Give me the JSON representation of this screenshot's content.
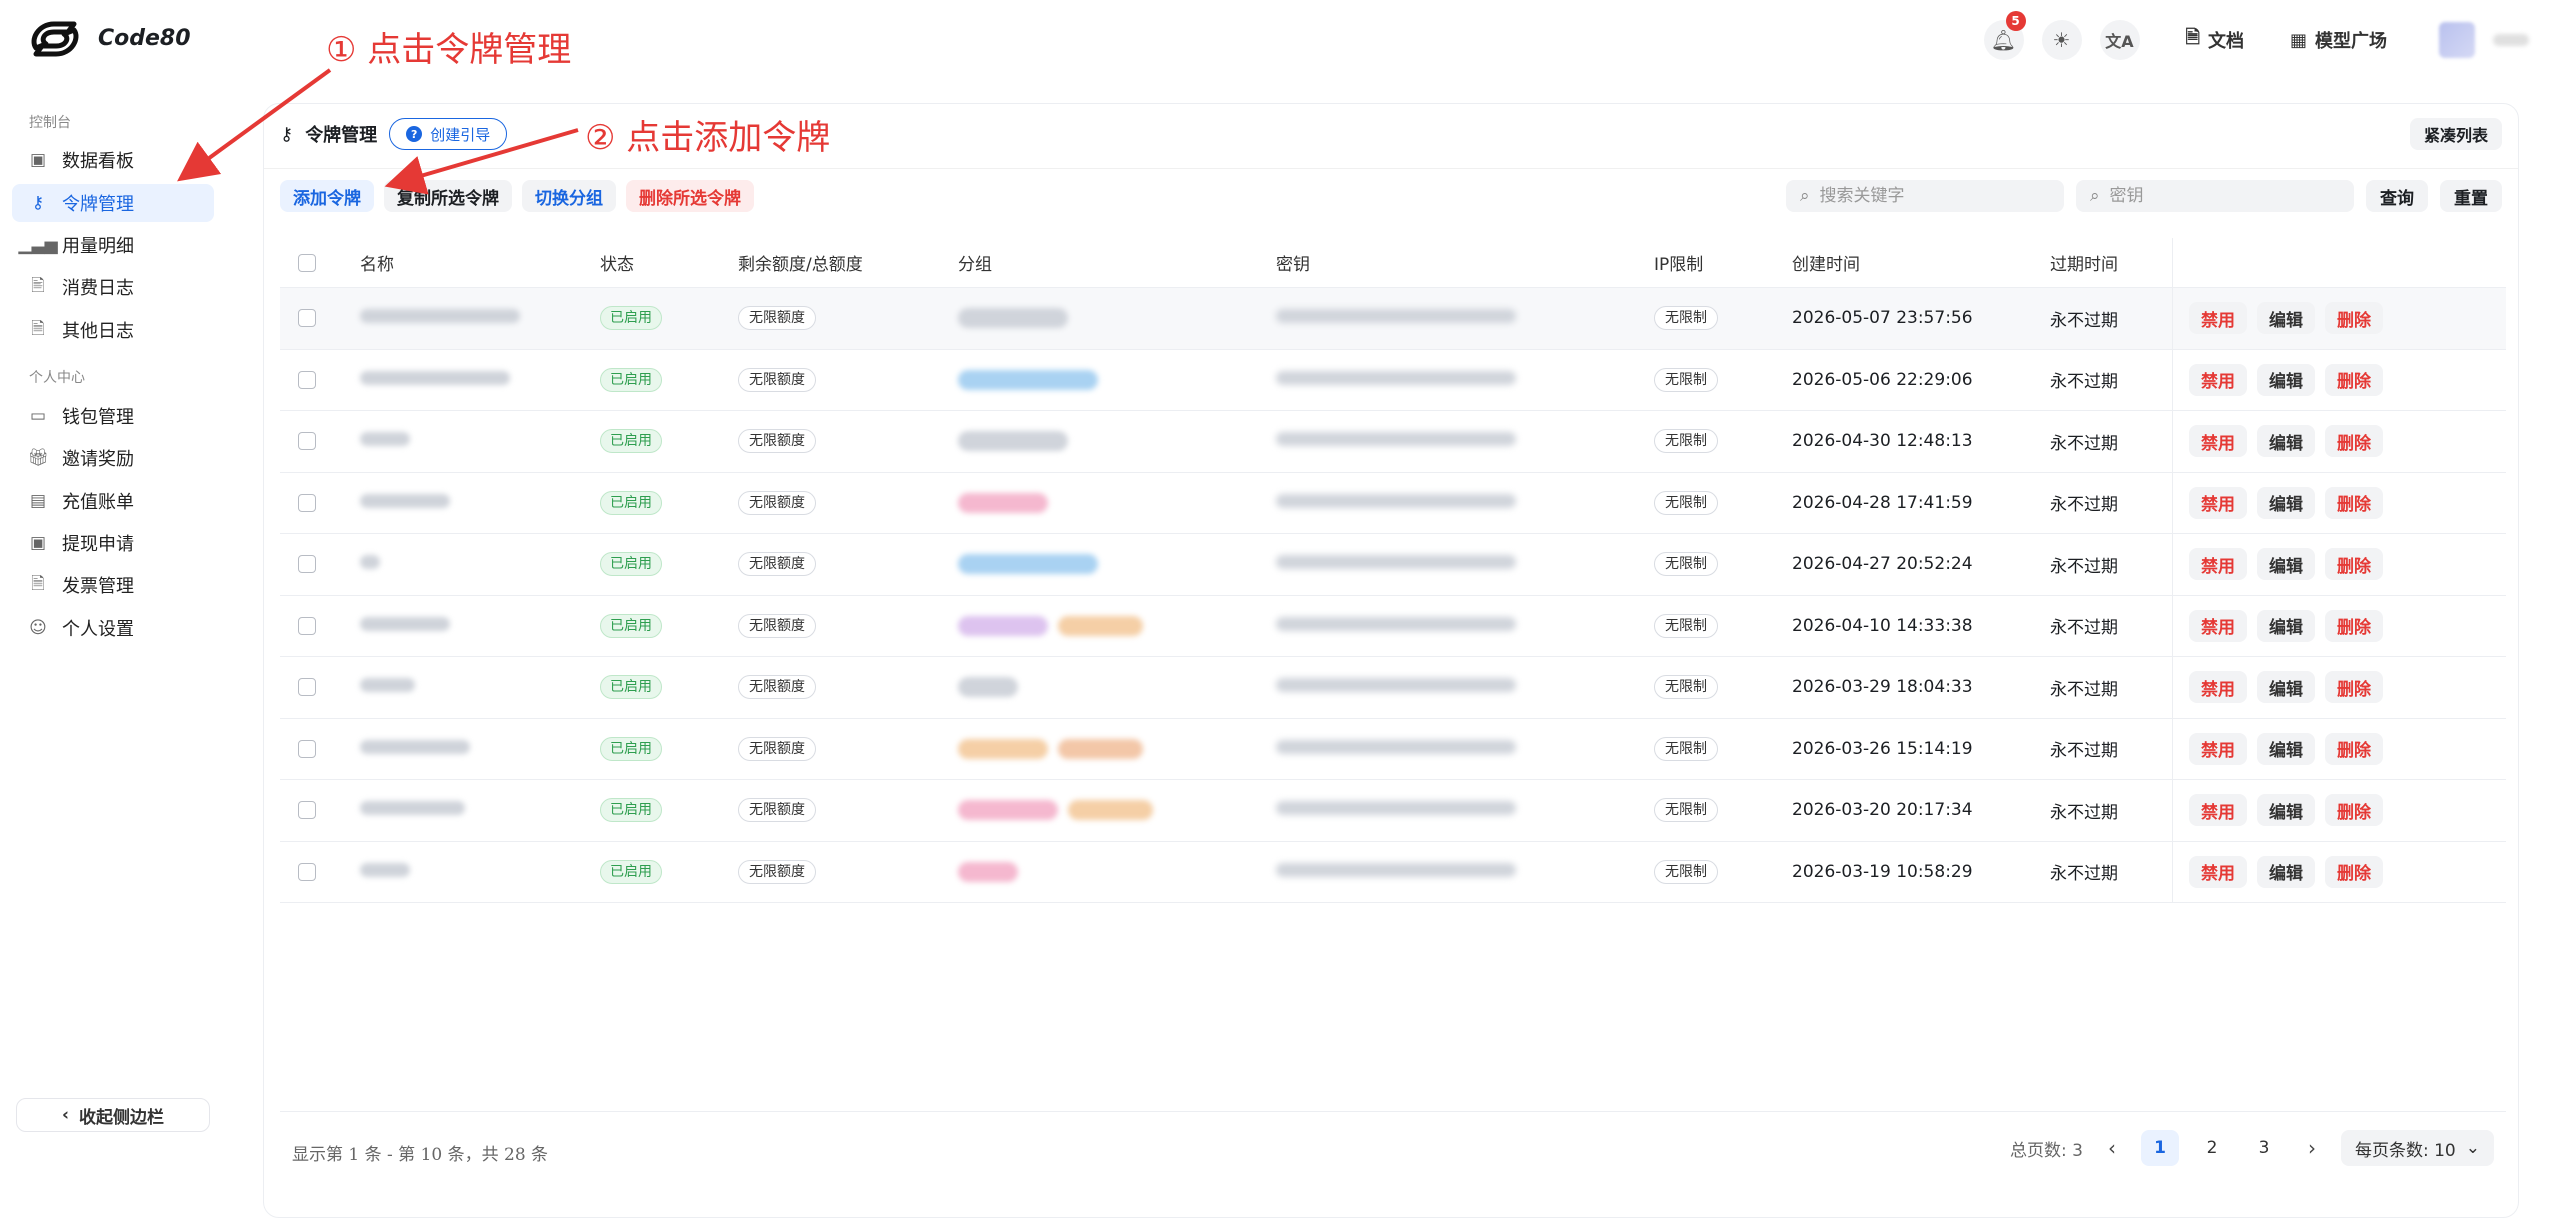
{
  "header": {
    "brand": "Code80",
    "notifications_count": "5",
    "docs_label": "文档",
    "models_label": "模型广场"
  },
  "sidebar": {
    "section_console": "控制台",
    "section_personal": "个人中心",
    "items_console": [
      {
        "label": "数据看板",
        "icon": "dashboard-icon"
      },
      {
        "label": "令牌管理",
        "icon": "key-icon",
        "active": true
      },
      {
        "label": "用量明细",
        "icon": "bar-chart-icon"
      },
      {
        "label": "消费日志",
        "icon": "receipt-icon"
      },
      {
        "label": "其他日志",
        "icon": "document-icon"
      }
    ],
    "items_personal": [
      {
        "label": "钱包管理",
        "icon": "wallet-icon"
      },
      {
        "label": "邀请奖励",
        "icon": "gift-icon"
      },
      {
        "label": "充值账单",
        "icon": "calendar-icon"
      },
      {
        "label": "提现申请",
        "icon": "cash-icon"
      },
      {
        "label": "发票管理",
        "icon": "invoice-icon"
      },
      {
        "label": "个人设置",
        "icon": "user-icon"
      }
    ],
    "collapse_label": "收起侧边栏"
  },
  "page": {
    "title": "令牌管理",
    "guide_label": "创建引导",
    "compact_label": "紧凑列表"
  },
  "toolbar": {
    "add": "添加令牌",
    "copy": "复制所选令牌",
    "switch_group": "切换分组",
    "delete_selected": "删除所选令牌",
    "search_placeholder": "搜索关键字",
    "key_placeholder": "密钥",
    "query": "查询",
    "reset": "重置"
  },
  "table": {
    "columns": [
      "名称",
      "状态",
      "剩余额度/总额度",
      "分组",
      "密钥",
      "IP限制",
      "创建时间",
      "过期时间"
    ],
    "rows": [
      {
        "status": "已启用",
        "quota": "无限额度",
        "ip": "无限制",
        "created": "2026-05-07 23:57:56",
        "expire": "永不过期"
      },
      {
        "status": "已启用",
        "quota": "无限额度",
        "ip": "无限制",
        "created": "2026-05-06 22:29:06",
        "expire": "永不过期"
      },
      {
        "status": "已启用",
        "quota": "无限额度",
        "ip": "无限制",
        "created": "2026-04-30 12:48:13",
        "expire": "永不过期"
      },
      {
        "status": "已启用",
        "quota": "无限额度",
        "ip": "无限制",
        "created": "2026-04-28 17:41:59",
        "expire": "永不过期"
      },
      {
        "status": "已启用",
        "quota": "无限额度",
        "ip": "无限制",
        "created": "2026-04-27 20:52:24",
        "expire": "永不过期"
      },
      {
        "status": "已启用",
        "quota": "无限额度",
        "ip": "无限制",
        "created": "2026-04-10 14:33:38",
        "expire": "永不过期"
      },
      {
        "status": "已启用",
        "quota": "无限额度",
        "ip": "无限制",
        "created": "2026-03-29 18:04:33",
        "expire": "永不过期"
      },
      {
        "status": "已启用",
        "quota": "无限额度",
        "ip": "无限制",
        "created": "2026-03-26 15:14:19",
        "expire": "永不过期"
      },
      {
        "status": "已启用",
        "quota": "无限额度",
        "ip": "无限制",
        "created": "2026-03-20 20:17:34",
        "expire": "永不过期"
      },
      {
        "status": "已启用",
        "quota": "无限额度",
        "ip": "无限制",
        "created": "2026-03-19 10:58:29",
        "expire": "永不过期"
      }
    ],
    "op_ban": "禁用",
    "op_edit": "编辑",
    "op_delete": "删除"
  },
  "footer": {
    "info": "显示第 1 条 - 第 10 条，共 28 条",
    "total_pages_label": "总页数: 3",
    "pages": [
      "1",
      "2",
      "3"
    ],
    "page_size_label": "每页条数: 10"
  },
  "annotations": {
    "step1": "① 点击令牌管理",
    "step2": "② 点击添加令牌"
  },
  "colors": {
    "primary": "#1a66e0",
    "danger": "#e53935",
    "success": "#2e9e4f"
  }
}
